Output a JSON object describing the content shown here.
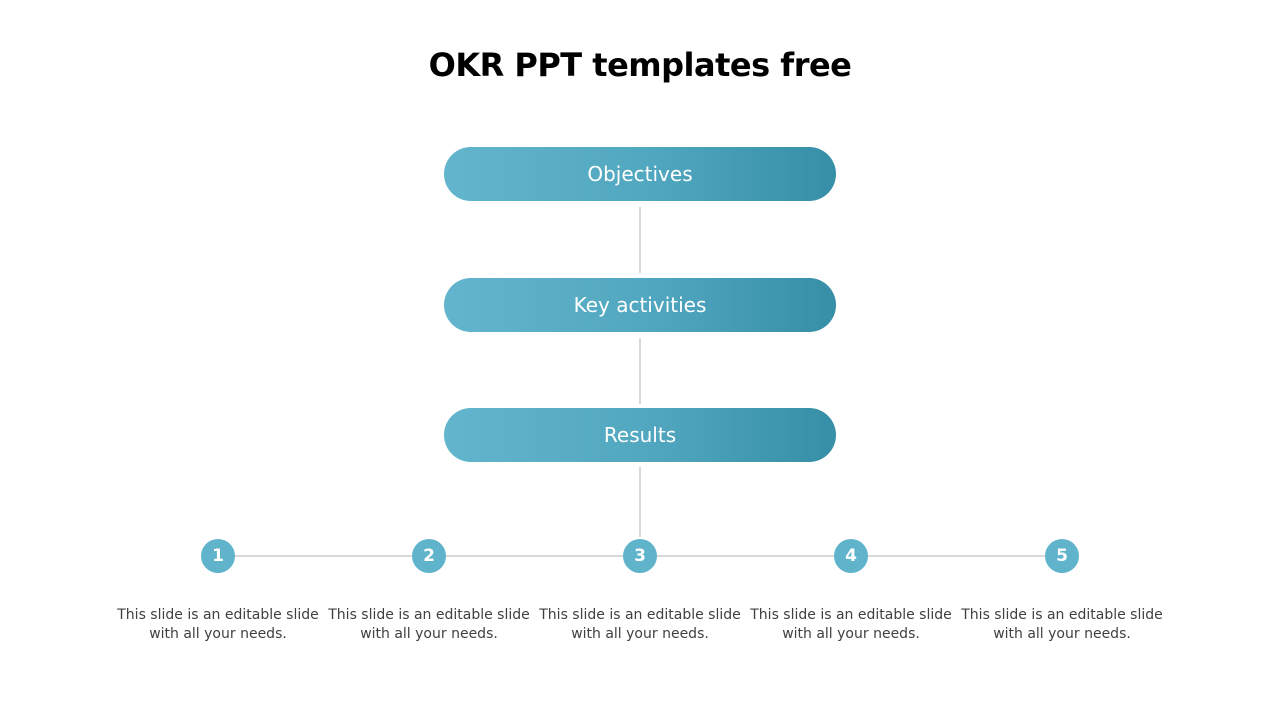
{
  "title": "OKR PPT templates free",
  "levels": [
    {
      "label": "Objectives"
    },
    {
      "label": "Key activities"
    },
    {
      "label": "Results"
    }
  ],
  "steps": [
    {
      "number": "1",
      "text": "This slide is an editable slide with all your needs."
    },
    {
      "number": "2",
      "text": "This slide is an editable slide with all your needs."
    },
    {
      "number": "3",
      "text": "This slide is an editable slide with all your needs."
    },
    {
      "number": "4",
      "text": "This slide is an editable slide with all your needs."
    },
    {
      "number": "5",
      "text": "This slide is an editable slide with all your needs."
    }
  ],
  "colors": {
    "accent": "#5fb3cb",
    "gradient_start": "#62b5cc",
    "gradient_end": "#368fa7",
    "connector": "#d9d9d9"
  }
}
